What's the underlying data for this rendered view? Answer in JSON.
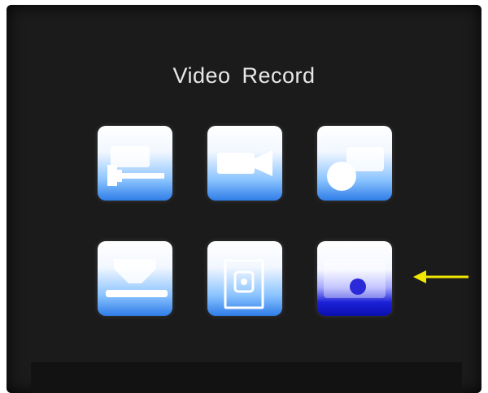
{
  "screen": {
    "title": "Video Record"
  },
  "menu": {
    "items": [
      {
        "name": "settings",
        "icon": "wrench-icon"
      },
      {
        "name": "video-camera",
        "icon": "video-camera-icon"
      },
      {
        "name": "snapshot",
        "icon": "camera-lens-icon"
      },
      {
        "name": "download",
        "icon": "download-icon"
      },
      {
        "name": "storage",
        "icon": "memory-card-icon"
      },
      {
        "name": "record",
        "icon": "record-dot-icon",
        "selected": true
      }
    ]
  },
  "colors": {
    "background": "#1b1b1b",
    "tile_blue": "#2f7de8",
    "selected_blue": "#1b20d6",
    "pointer_arrow": "#f0e800"
  }
}
